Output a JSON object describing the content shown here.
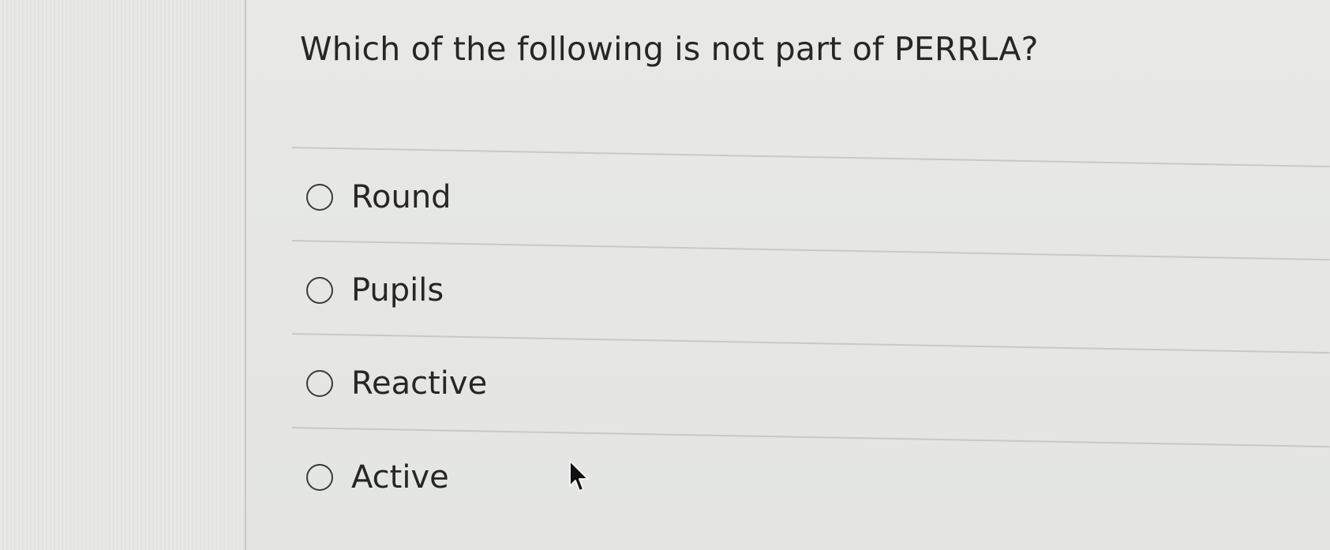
{
  "quiz": {
    "question": "Which of the following is not part of PERRLA?",
    "options": [
      {
        "label": "Round"
      },
      {
        "label": "Pupils"
      },
      {
        "label": "Reactive"
      },
      {
        "label": "Active"
      }
    ]
  },
  "colors": {
    "text": "#262626",
    "background": "#e6e7e5",
    "divider": "#c8c9c7"
  },
  "icons": {
    "radio": "radio-unselected-icon",
    "pointer": "mouse-pointer-icon"
  }
}
